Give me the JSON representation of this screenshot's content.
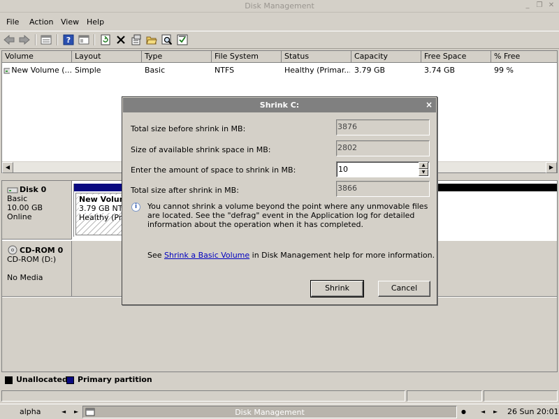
{
  "window": {
    "title": "Disk Management",
    "minimize": "_",
    "restore": "❐",
    "close": "✕"
  },
  "menu": [
    "File",
    "Action",
    "View",
    "Help"
  ],
  "toolbar": [
    "back-icon",
    "forward-icon",
    "properties-icon",
    "help-icon",
    "console-icon",
    "refresh-icon",
    "delete-icon",
    "settings-icon",
    "open-folder-icon",
    "search-icon",
    "check-disk-icon"
  ],
  "volume_list": {
    "columns": [
      "Volume",
      "Layout",
      "Type",
      "File System",
      "Status",
      "Capacity",
      "Free Space",
      "% Free"
    ],
    "rows": [
      {
        "volume": "New Volume (...",
        "layout": "Simple",
        "type": "Basic",
        "filesystem": "NTFS",
        "status": "Healthy (Primar...",
        "capacity": "3.79 GB",
        "free": "3.74 GB",
        "pct_free": "99 %"
      }
    ]
  },
  "disks": [
    {
      "name": "Disk 0",
      "kind": "Basic",
      "size": "10.00 GB",
      "state": "Online",
      "volume": {
        "name": "New Volume",
        "detail": "3.79 GB NTFS",
        "status": "Healthy (Prim"
      }
    },
    {
      "name": "CD-ROM 0",
      "kind": "CD-ROM (D:)",
      "state": "No Media"
    }
  ],
  "legend": {
    "unallocated": "Unallocated",
    "primary": "Primary partition",
    "unallocated_color": "#000000",
    "primary_color": "#0a0a80"
  },
  "taskbar": {
    "left": "alpha",
    "center": "Disk Management",
    "clock": "26 Sun 20:01"
  },
  "dialog": {
    "title": "Shrink C:",
    "close": "×",
    "total_before_label": "Total size before shrink in MB:",
    "total_before_value": "3876",
    "available_label": "Size of available shrink space in MB:",
    "available_value": "2802",
    "amount_label": "Enter the amount of space to shrink in MB:",
    "amount_value": "10",
    "total_after_label": "Total size after shrink in MB:",
    "total_after_value": "3866",
    "info_text": "You cannot shrink a volume beyond the point where any unmovable files are located. See the \"defrag\" event in the Application log for detailed information about the operation when it has completed.",
    "help_prefix": "See ",
    "help_link": "Shrink a Basic Volume",
    "help_suffix": " in Disk Management help for more information.",
    "shrink_button": "Shrink",
    "cancel_button": "Cancel"
  }
}
